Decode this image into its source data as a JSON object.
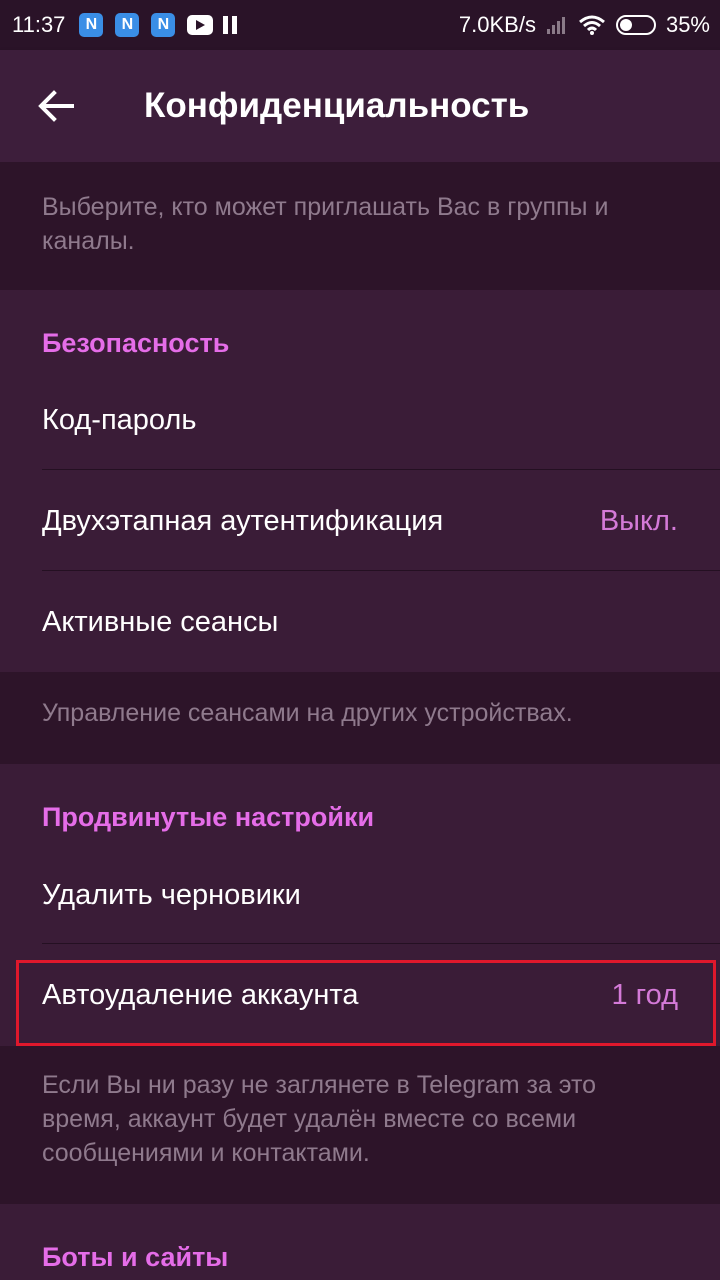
{
  "status_bar": {
    "time": "11:37",
    "notification_icons": [
      "N",
      "N",
      "N"
    ],
    "network_speed": "7.0KB/s",
    "battery_percent": "35%"
  },
  "appbar": {
    "title": "Конфиденциальность"
  },
  "groups_hint": "Выберите, кто может приглашать Вас в группы и каналы.",
  "security": {
    "header": "Безопасность",
    "items": [
      {
        "label": "Код-пароль",
        "value": ""
      },
      {
        "label": "Двухэтапная аутентификация",
        "value": "Выкл."
      },
      {
        "label": "Активные сеансы",
        "value": ""
      }
    ],
    "hint": "Управление сеансами на других устройствах."
  },
  "advanced": {
    "header": "Продвинутые настройки",
    "items": [
      {
        "label": "Удалить черновики",
        "value": ""
      },
      {
        "label": "Автоудаление аккаунта",
        "value": "1 год"
      }
    ],
    "hint": "Если Вы ни разу не заглянете в Telegram за это время, аккаунт будет удалён вместе со всеми сообщениями и контактами."
  },
  "bots": {
    "header": "Боты и сайты"
  },
  "colors": {
    "background": "#3a1c37",
    "hint_background": "#2d1429",
    "accent": "#e56de8",
    "value": "#d47ad8",
    "highlight": "#e0182c"
  }
}
